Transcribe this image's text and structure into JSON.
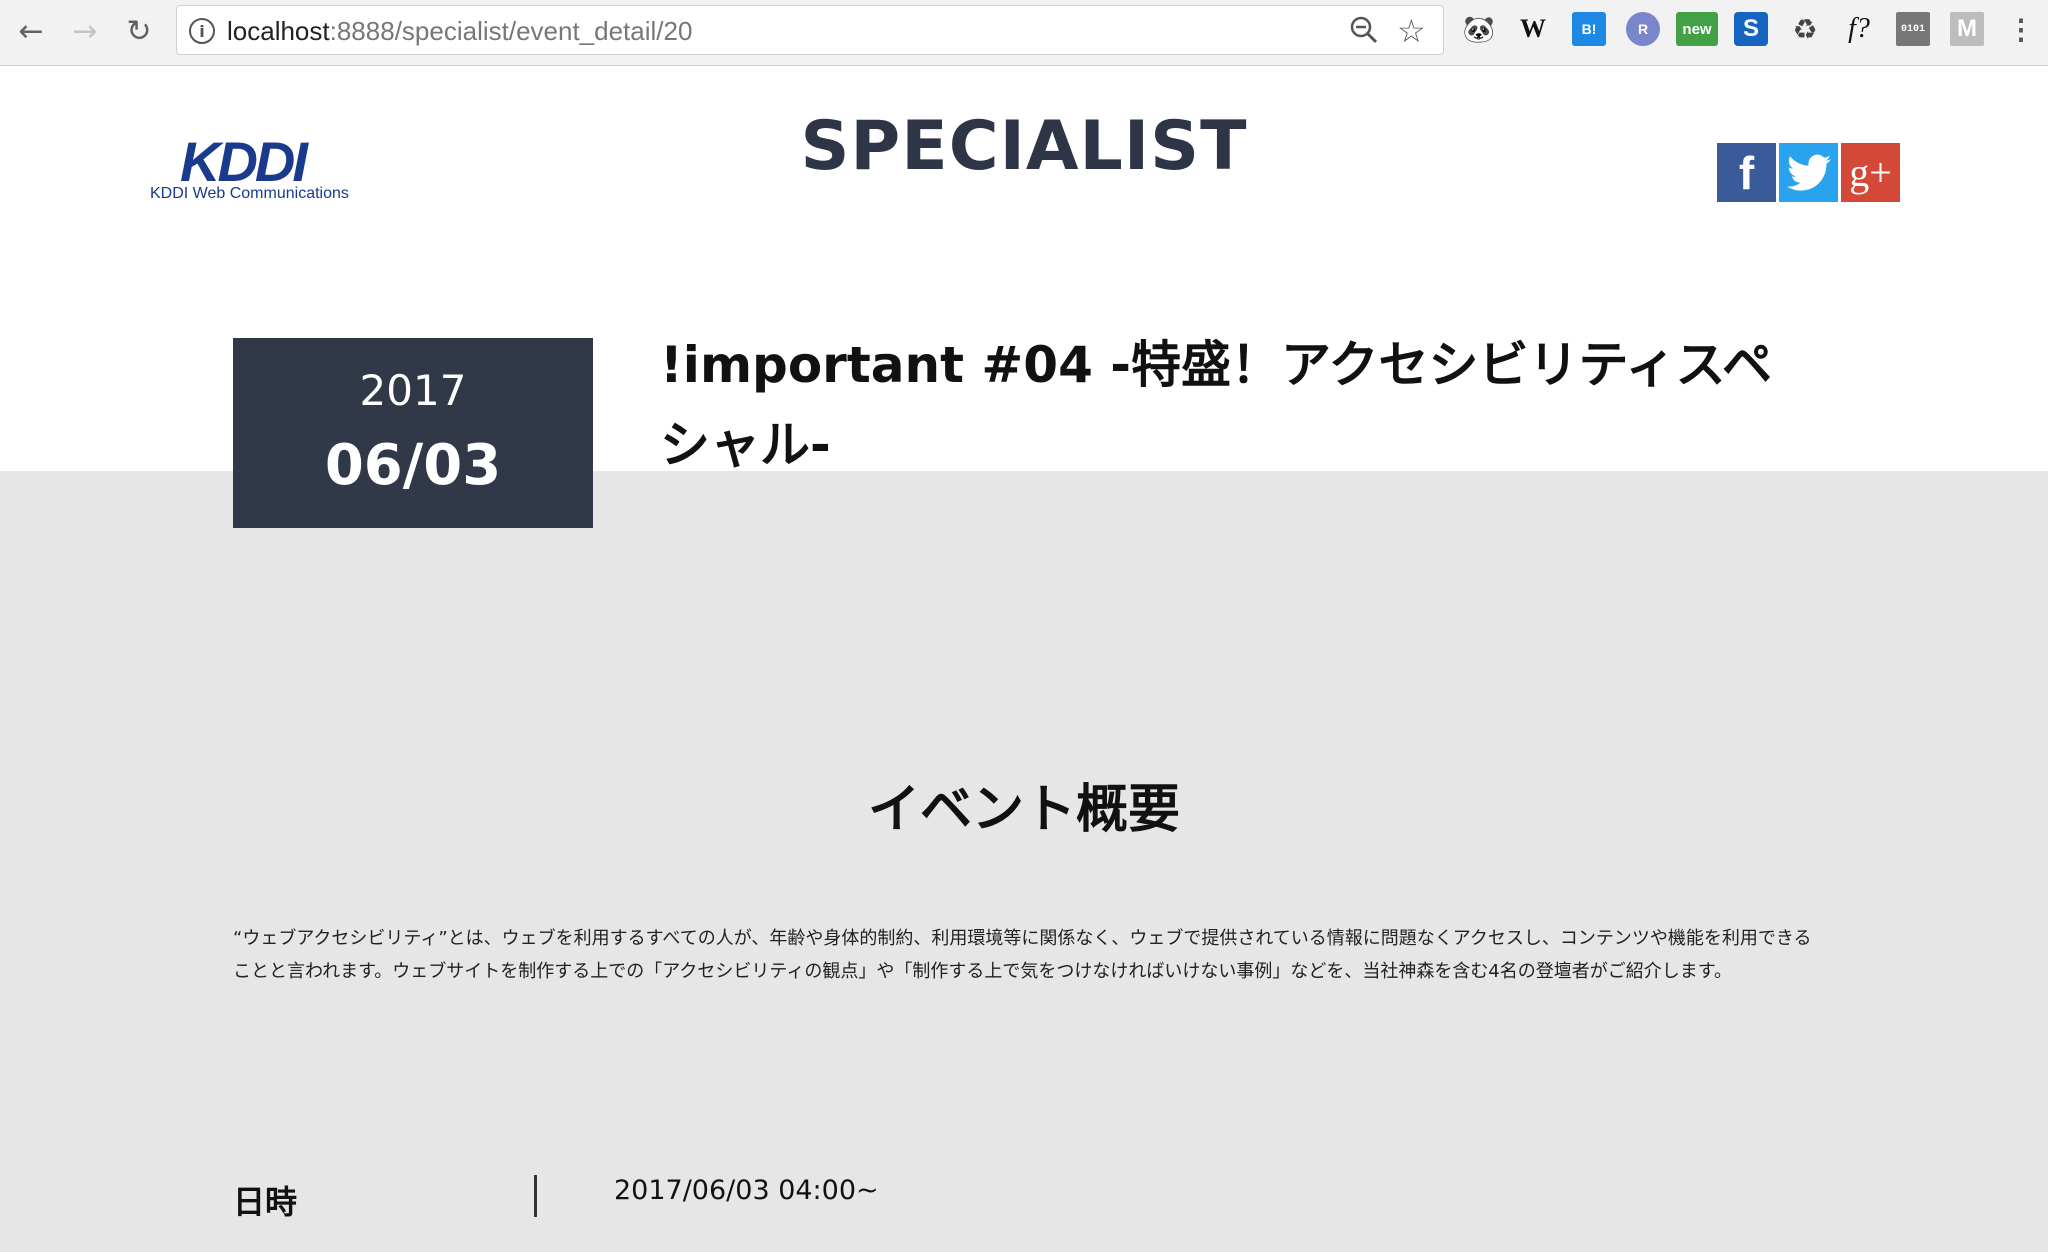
{
  "browser": {
    "url_host": "localhost",
    "url_path": ":8888/specialist/event_detail/20",
    "extensions": [
      {
        "name": "panda-extension-icon",
        "glyph": "🐼"
      },
      {
        "name": "wikipedia-extension-icon",
        "glyph": "W"
      },
      {
        "name": "bookmark-extension-icon",
        "glyph": "B!"
      },
      {
        "name": "r-extension-icon",
        "glyph": "R"
      },
      {
        "name": "new-extension-icon",
        "glyph": "new"
      },
      {
        "name": "s-extension-icon",
        "glyph": "S"
      },
      {
        "name": "recycle-extension-icon",
        "glyph": "♻"
      },
      {
        "name": "f-question-extension-icon",
        "glyph": "f?"
      },
      {
        "name": "binary-extension-icon",
        "glyph": "0101"
      },
      {
        "name": "m-extension-icon",
        "glyph": "M"
      }
    ]
  },
  "header": {
    "logo_mark": "KDDI",
    "logo_caption": "KDDI Web Communications",
    "site_title": "SPECIALIST",
    "social": {
      "facebook": "f",
      "google_plus": "g+"
    }
  },
  "event": {
    "year": "2017",
    "month_day": "06/03",
    "title": "!important #04 -特盛！アクセシビリティスペシャル-"
  },
  "overview": {
    "heading": "イベント概要",
    "description": "“ウェブアクセシビリティ”とは、ウェブを利用するすべての人が、年齢や身体的制約、利用環境等に関係なく、ウェブで提供されている情報に問題なくアクセスし、コンテンツや機能を利用できることと言われます。ウェブサイトを制作する上での「アクセシビリティの観点」や「制作する上で気をつけなければいけない事例」などを、当社神森を含む4名の登壇者がご紹介します。"
  },
  "details": [
    {
      "label": "日時",
      "value": "2017/06/03 04:00~"
    }
  ]
}
